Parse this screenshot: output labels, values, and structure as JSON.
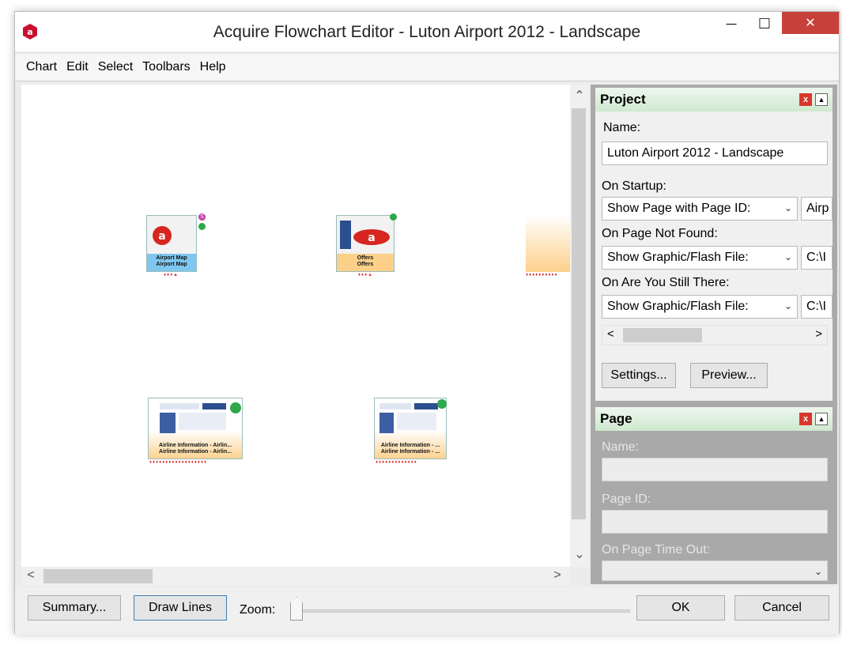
{
  "window": {
    "title": "Acquire Flowchart Editor - Luton Airport 2012 - Landscape",
    "close_glyph": "✕"
  },
  "menu": {
    "items": [
      "Chart",
      "Edit",
      "Select",
      "Toolbars",
      "Help"
    ]
  },
  "canvas": {
    "nodes": [
      {
        "line1": "Airport Map",
        "line2": "Airport Map",
        "badge_top": "S"
      },
      {
        "line1": "Offers",
        "line2": "Offers"
      },
      {
        "line1": "Airline Information - Airlin...",
        "line2": "Airline Information - Airlin..."
      },
      {
        "line1": "Airline Information - ...",
        "line2": "Airline Information - ..."
      }
    ]
  },
  "project_panel": {
    "title": "Project",
    "name_label": "Name:",
    "name_value": "Luton Airport 2012 - Landscape",
    "on_startup_label": "On Startup:",
    "on_startup_value": "Show Page with Page ID:",
    "on_startup_extra": "Airp",
    "on_not_found_label": "On Page Not Found:",
    "on_not_found_value": "Show Graphic/Flash File:",
    "on_not_found_extra": "C:\\I",
    "on_still_there_label": "On Are You Still There:",
    "on_still_there_value": "Show Graphic/Flash File:",
    "on_still_there_extra": "C:\\I",
    "settings_button": "Settings...",
    "preview_button": "Preview..."
  },
  "page_panel": {
    "title": "Page",
    "name_label": "Name:",
    "page_id_label": "Page ID:",
    "timeout_label": "On Page Time Out:"
  },
  "bottom": {
    "summary_button": "Summary...",
    "draw_lines_button": "Draw Lines",
    "zoom_label": "Zoom:",
    "zoom_level": 0.0,
    "ok_button": "OK",
    "cancel_button": "Cancel"
  },
  "colors": {
    "accent_green": "#cfe8cf",
    "close_red": "#c7403a",
    "node_orange": "#fdd08a",
    "node_blue": "#7fc7ef"
  }
}
